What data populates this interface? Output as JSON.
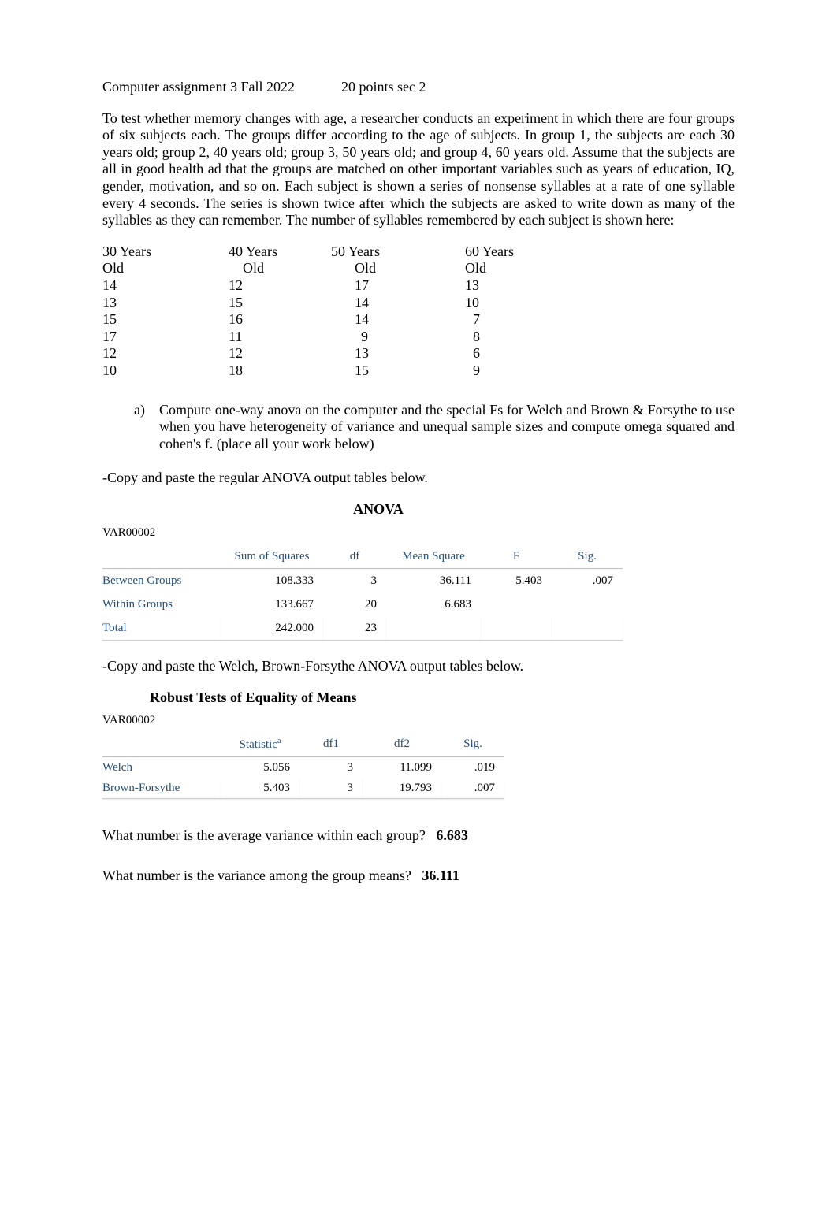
{
  "title": {
    "left": "Computer assignment 3 Fall 2022",
    "right": "20 points sec 2"
  },
  "paragraph": "To test whether memory changes with age, a researcher conducts an experiment in which there are four groups of six subjects each.  The groups differ according to the age of subjects.  In group 1, the subjects are each 30 years old; group 2, 40 years old; group 3, 50 years old; and group 4, 60 years old.  Assume that the subjects are all in good health ad that the groups are matched on other important variables such as years of education, IQ, gender, motivation, and so on.  Each subject is shown a series of nonsense syllables at a rate of one syllable every 4 seconds.  The series is shown twice after which the subjects are asked to write down as many of the syllables as they can remember.  The number of syllables remembered by each subject is shown here:",
  "data_table": {
    "headers_line1": [
      "30 Years",
      "40 Years",
      "50 Years",
      "60 Years"
    ],
    "headers_line2": [
      "Old",
      "Old",
      "Old",
      "Old"
    ],
    "rows": [
      [
        "14",
        "12",
        "17",
        "13"
      ],
      [
        "13",
        "15",
        "14",
        "10"
      ],
      [
        "15",
        "16",
        "14",
        "7"
      ],
      [
        "17",
        "11",
        "9",
        "8"
      ],
      [
        "12",
        "12",
        "13",
        "6"
      ],
      [
        "10",
        "18",
        "15",
        "9"
      ]
    ]
  },
  "question_a": {
    "marker": "a)",
    "text": "Compute one-way anova on the computer and the special Fs for Welch and Brown & Forsythe to   use when you have heterogeneity of variance and unequal sample sizes and  compute omega squared and cohen's f. (place all your work below)"
  },
  "instr1": "-Copy and paste the regular ANOVA output tables below.",
  "anova": {
    "heading": "ANOVA",
    "var": "VAR00002",
    "col_headers": [
      "",
      "Sum of Squares",
      "df",
      "Mean Square",
      "F",
      "Sig."
    ],
    "rows": [
      {
        "label": "Between Groups",
        "ss": "108.333",
        "df": "3",
        "ms": "36.111",
        "f": "5.403",
        "sig": ".007"
      },
      {
        "label": "Within Groups",
        "ss": "133.667",
        "df": "20",
        "ms": "6.683",
        "f": "",
        "sig": ""
      },
      {
        "label": "Total",
        "ss": "242.000",
        "df": "23",
        "ms": "",
        "f": "",
        "sig": ""
      }
    ]
  },
  "instr2": "-Copy and paste the Welch, Brown-Forsythe  ANOVA output tables below.",
  "robust": {
    "heading": "Robust Tests of Equality of Means",
    "var": "VAR00002",
    "col_headers": [
      "",
      "Statistic",
      "df1",
      "df2",
      "Sig."
    ],
    "superscript": "a",
    "rows": [
      {
        "label": "Welch",
        "stat": "5.056",
        "df1": "3",
        "df2": "11.099",
        "sig": ".019"
      },
      {
        "label": "Brown-Forsythe",
        "stat": "5.403",
        "df1": "3",
        "df2": "19.793",
        "sig": ".007"
      }
    ]
  },
  "qa1": {
    "q": "What number is the average variance within each group?",
    "a": "6.683"
  },
  "qa2": {
    "q": "What number is the variance among the group means?",
    "a": "36.111"
  }
}
